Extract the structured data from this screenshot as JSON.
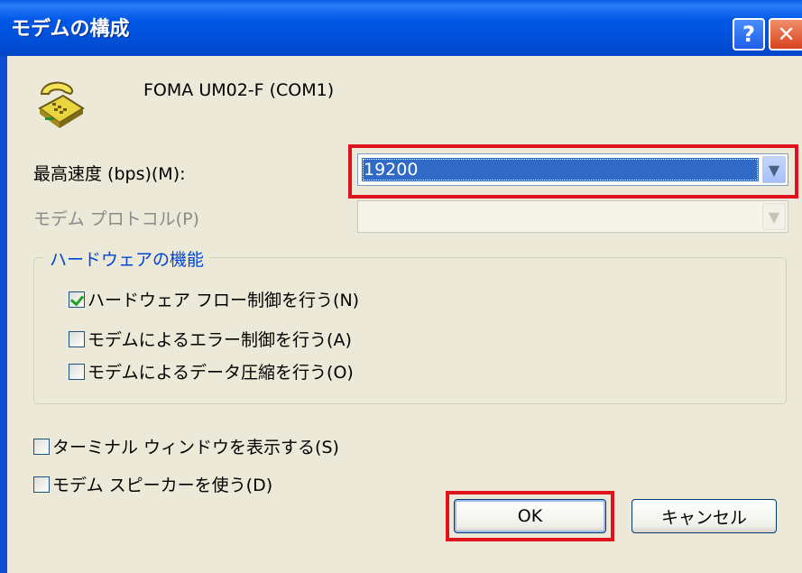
{
  "window": {
    "title": "モデムの構成",
    "help_glyph": "?",
    "close_glyph": "✕"
  },
  "modem": {
    "name": "FOMA UM02-F (COM1)",
    "icon": "telephone-modem-icon"
  },
  "max_speed": {
    "label": "最高速度 (bps)(M):",
    "value": "19200"
  },
  "protocol": {
    "label": "モデム プロトコル(P)",
    "value": ""
  },
  "hardware_group": {
    "legend": "ハードウェアの機能",
    "options": [
      {
        "label": "ハードウェア フロー制御を行う(N)",
        "checked": true
      },
      {
        "label": "モデムによるエラー制御を行う(A)",
        "checked": false
      },
      {
        "label": "モデムによるデータ圧縮を行う(O)",
        "checked": false
      }
    ]
  },
  "extra_options": [
    {
      "label": "ターミナル ウィンドウを表示する(S)",
      "checked": false
    },
    {
      "label": "モデム スピーカーを使う(D)",
      "checked": false
    }
  ],
  "buttons": {
    "ok": "OK",
    "cancel": "キャンセル"
  },
  "highlight_color": "#e0141e"
}
